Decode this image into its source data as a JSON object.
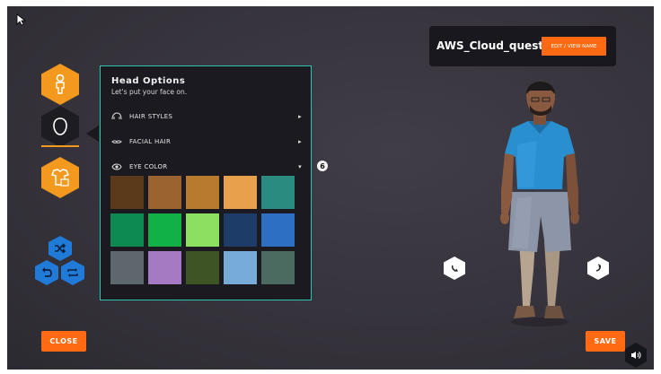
{
  "panel": {
    "title": "Head Options",
    "subtitle": "Let's put your face on.",
    "rows": [
      {
        "label": "HAIR STYLES",
        "icon": "hair-icon",
        "expanded": false
      },
      {
        "label": "FACIAL HAIR",
        "icon": "mustache-icon",
        "expanded": false
      },
      {
        "label": "EYE COLOR",
        "icon": "eye-icon",
        "expanded": true
      }
    ],
    "eye_colors": [
      "#5a3a1a",
      "#9a6430",
      "#b87a2e",
      "#e9a04c",
      "#2a8c80",
      "#0c8a52",
      "#11b148",
      "#8ddf60",
      "#1e3c68",
      "#2d6fc2",
      "#5e666e",
      "#a67ac2",
      "#3f5424",
      "#77acd8",
      "#4b6a60"
    ]
  },
  "step_badge": "6",
  "user": {
    "name": "AWS_Cloud_quest",
    "edit_label": "EDIT / VIEW NAME"
  },
  "buttons": {
    "close": "CLOSE",
    "save": "SAVE"
  },
  "colors": {
    "accent": "#ff6a13",
    "icon_orange": "#f39a1e",
    "panel_border": "#2bc6b0",
    "icon_blue": "#1f7ad8"
  }
}
